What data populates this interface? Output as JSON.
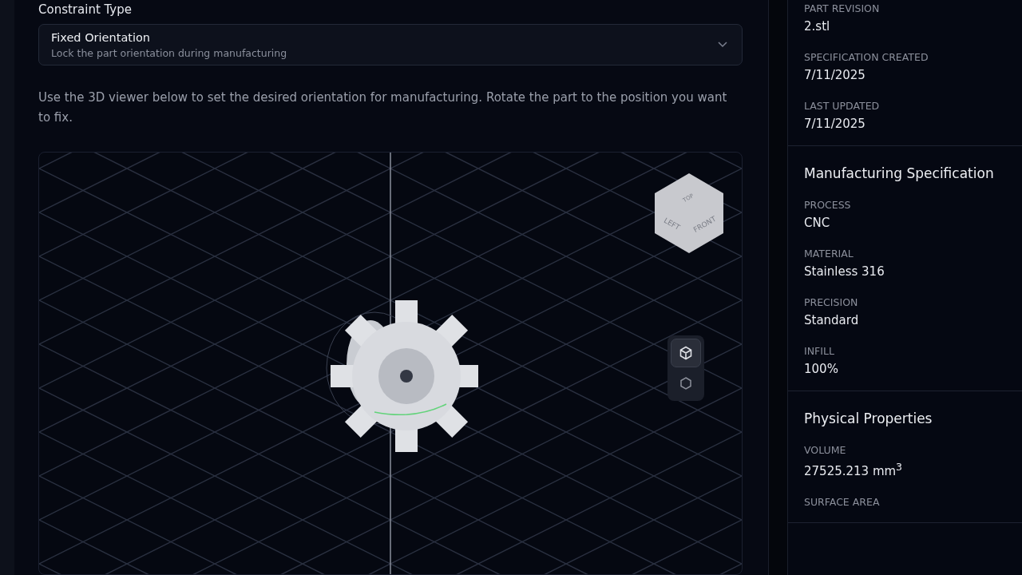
{
  "constraint": {
    "label": "Constraint Type",
    "select": {
      "title": "Fixed Orientation",
      "description": "Lock the part orientation during manufacturing"
    }
  },
  "instructions": "Use the 3D viewer below to set the desired orientation for manufacturing. Rotate the part to the position you want to fix.",
  "viewer": {
    "cube_labels": [
      "TOP",
      "LEFT",
      "FRONT"
    ],
    "tools": [
      {
        "kind": "cube",
        "selected": true
      },
      {
        "kind": "sphere",
        "selected": false
      }
    ]
  },
  "panel": [
    {
      "fields": [
        {
          "label": "PART REVISION",
          "value": "2.stl"
        },
        {
          "label": "SPECIFICATION CREATED",
          "value": "7/11/2025"
        },
        {
          "label": "LAST UPDATED",
          "value": "7/11/2025"
        }
      ]
    },
    {
      "title": "Manufacturing Specification",
      "fields": [
        {
          "label": "PROCESS",
          "value": "CNC"
        },
        {
          "label": "MATERIAL",
          "value": "Stainless 316"
        },
        {
          "label": "PRECISION",
          "value": "Standard"
        },
        {
          "label": "INFILL",
          "value": "100%"
        }
      ]
    },
    {
      "title": "Physical Properties",
      "fields": [
        {
          "label": "VOLUME",
          "value": "27525.213 mm$^{3}$"
        },
        {
          "label": "SURFACE AREA"
        }
      ]
    }
  ]
}
